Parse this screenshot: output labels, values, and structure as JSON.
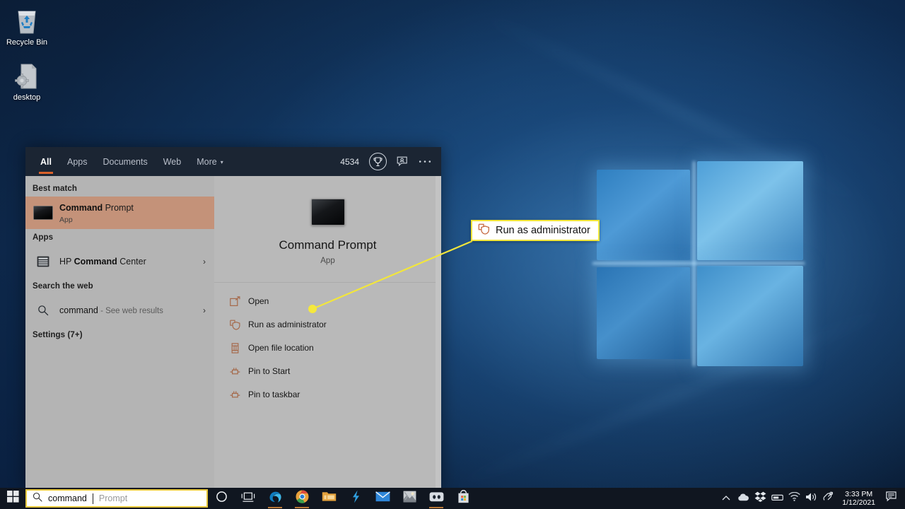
{
  "desktop": {
    "icons": [
      {
        "name": "Recycle Bin",
        "icon": "recycle-bin-icon"
      },
      {
        "name": "desktop",
        "icon": "config-file-icon"
      }
    ]
  },
  "search_flyout": {
    "tabs": [
      {
        "label": "All",
        "active": true
      },
      {
        "label": "Apps",
        "active": false
      },
      {
        "label": "Documents",
        "active": false
      },
      {
        "label": "Web",
        "active": false
      },
      {
        "label": "More",
        "active": false,
        "caret": "▾"
      }
    ],
    "rewards_points": "4534",
    "rewards_icon": "trophy-icon",
    "feedback_icon": "feedback-icon",
    "more_options_icon": "ellipsis-icon",
    "groups": {
      "best_match_header": "Best match",
      "apps_header": "Apps",
      "web_header": "Search the web",
      "settings_header": "Settings (7+)"
    },
    "best_match": {
      "title_bold": "Command",
      "title_rest": " Prompt",
      "subtitle": "App",
      "icon": "command-prompt-icon"
    },
    "apps_results": [
      {
        "prefix": "HP ",
        "bold": "Command",
        "suffix": " Center",
        "icon": "hp-command-center-icon",
        "chevron": "›"
      }
    ],
    "web_results": [
      {
        "query": "command",
        "hint": " - See web results",
        "icon": "search-icon",
        "chevron": "›"
      }
    ]
  },
  "preview": {
    "app_icon": "command-prompt-icon",
    "app_name": "Command Prompt",
    "app_kind": "App",
    "actions": [
      {
        "label": "Open",
        "icon": "open-window-icon"
      },
      {
        "label": "Run as administrator",
        "icon": "shield-icon"
      },
      {
        "label": "Open file location",
        "icon": "folder-location-icon"
      },
      {
        "label": "Pin to Start",
        "icon": "pin-icon"
      },
      {
        "label": "Pin to taskbar",
        "icon": "pin-taskbar-icon"
      }
    ]
  },
  "annotation": {
    "callout_label": "Run as administrator",
    "callout_icon": "shield-icon",
    "border_color": "#f2e63b",
    "line_color": "#f2e63b",
    "dot_color": "#f5e83c"
  },
  "taskbar": {
    "start_icon": "windows-logo-icon",
    "search": {
      "icon": "search-icon",
      "typed_value": "command",
      "suggestion_ghost": "Prompt",
      "border_color": "#e8c83c"
    },
    "items": [
      {
        "name": "cortana",
        "icon": "cortana-icon",
        "open": false
      },
      {
        "name": "task-view",
        "icon": "task-view-icon",
        "open": false
      },
      {
        "name": "microsoft-edge",
        "icon": "edge-icon",
        "open": true
      },
      {
        "name": "google-chrome",
        "icon": "chrome-icon",
        "open": true
      },
      {
        "name": "file-explorer",
        "icon": "file-explorer-icon",
        "open": false
      },
      {
        "name": "lightning-app",
        "icon": "lightning-icon",
        "open": false
      },
      {
        "name": "mail",
        "icon": "mail-icon",
        "open": false
      },
      {
        "name": "photos",
        "icon": "photos-icon",
        "open": false
      },
      {
        "name": "discord",
        "icon": "discord-icon",
        "open": true
      },
      {
        "name": "microsoft-store",
        "icon": "store-icon",
        "open": false
      }
    ],
    "tray": [
      {
        "name": "show-hidden-icons",
        "icon": "chevron-up-icon"
      },
      {
        "name": "onedrive",
        "icon": "cloud-icon"
      },
      {
        "name": "dropbox",
        "icon": "dropbox-icon"
      },
      {
        "name": "device",
        "icon": "device-icon"
      },
      {
        "name": "network",
        "icon": "wifi-icon"
      },
      {
        "name": "volume",
        "icon": "speaker-icon"
      },
      {
        "name": "bluetooth-connect",
        "icon": "connect-icon"
      }
    ],
    "clock": {
      "time": "3:33 PM",
      "date": "1/12/2021"
    },
    "action_center_icon": "notification-icon"
  }
}
